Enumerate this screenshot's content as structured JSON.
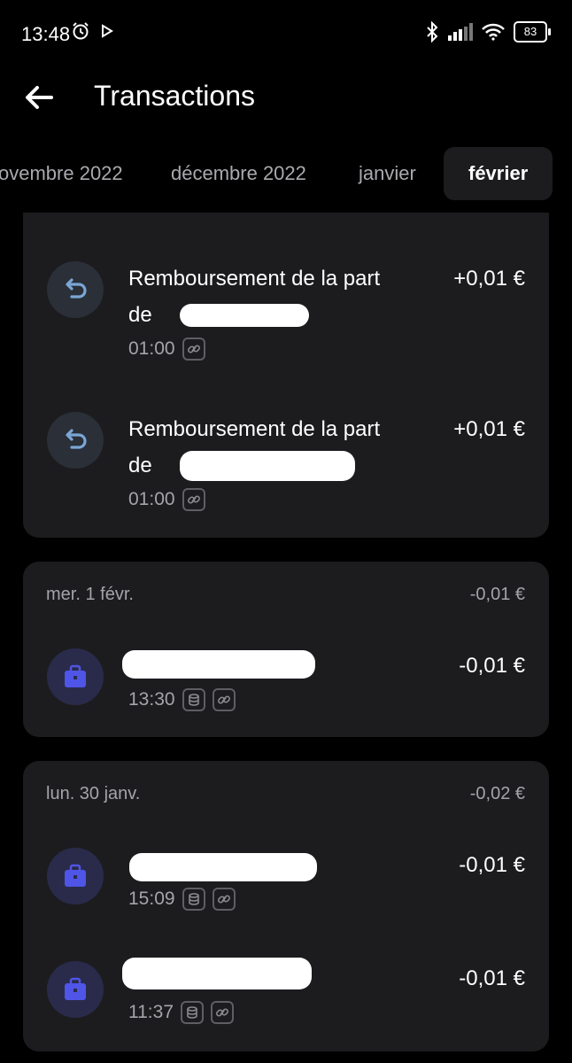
{
  "status_bar": {
    "time": "13:48",
    "battery": "83",
    "icons": [
      "alarm-icon",
      "play-icon",
      "bluetooth-icon",
      "signal-icon",
      "wifi-icon",
      "battery-icon"
    ]
  },
  "header": {
    "title": "Transactions",
    "back_icon": "arrow-left-icon"
  },
  "tabs": [
    {
      "label": "ovembre 2022",
      "active": false
    },
    {
      "label": "décembre 2022",
      "active": false
    },
    {
      "label": "janvier",
      "active": false
    },
    {
      "label": "février",
      "active": true
    }
  ],
  "groups": [
    {
      "transactions": [
        {
          "title_line1": "Remboursement de la part",
          "title_line2": "de",
          "amount": "+0,01 €",
          "time": "01:00",
          "icon": "refund-icon"
        },
        {
          "title_line1": "Remboursement de la part",
          "title_line2": "de",
          "amount": "+0,01 €",
          "time": "01:00",
          "icon": "refund-icon"
        }
      ]
    },
    {
      "date": "mer. 1 févr.",
      "total": "-0,01 €",
      "transactions": [
        {
          "amount": "-0,01 €",
          "time": "13:30",
          "icon": "briefcase-icon"
        }
      ]
    },
    {
      "date": "lun. 30 janv.",
      "total": "-0,02 €",
      "transactions": [
        {
          "amount": "-0,01 €",
          "time": "15:09",
          "icon": "briefcase-icon"
        },
        {
          "amount": "-0,01 €",
          "time": "11:37",
          "icon": "briefcase-icon"
        }
      ]
    }
  ],
  "colors": {
    "background": "#000000",
    "card": "#1c1c1f",
    "muted_text": "#a4a4a9",
    "refund_icon": "#7aa6d6",
    "briefcase_icon": "#4f55e6"
  }
}
